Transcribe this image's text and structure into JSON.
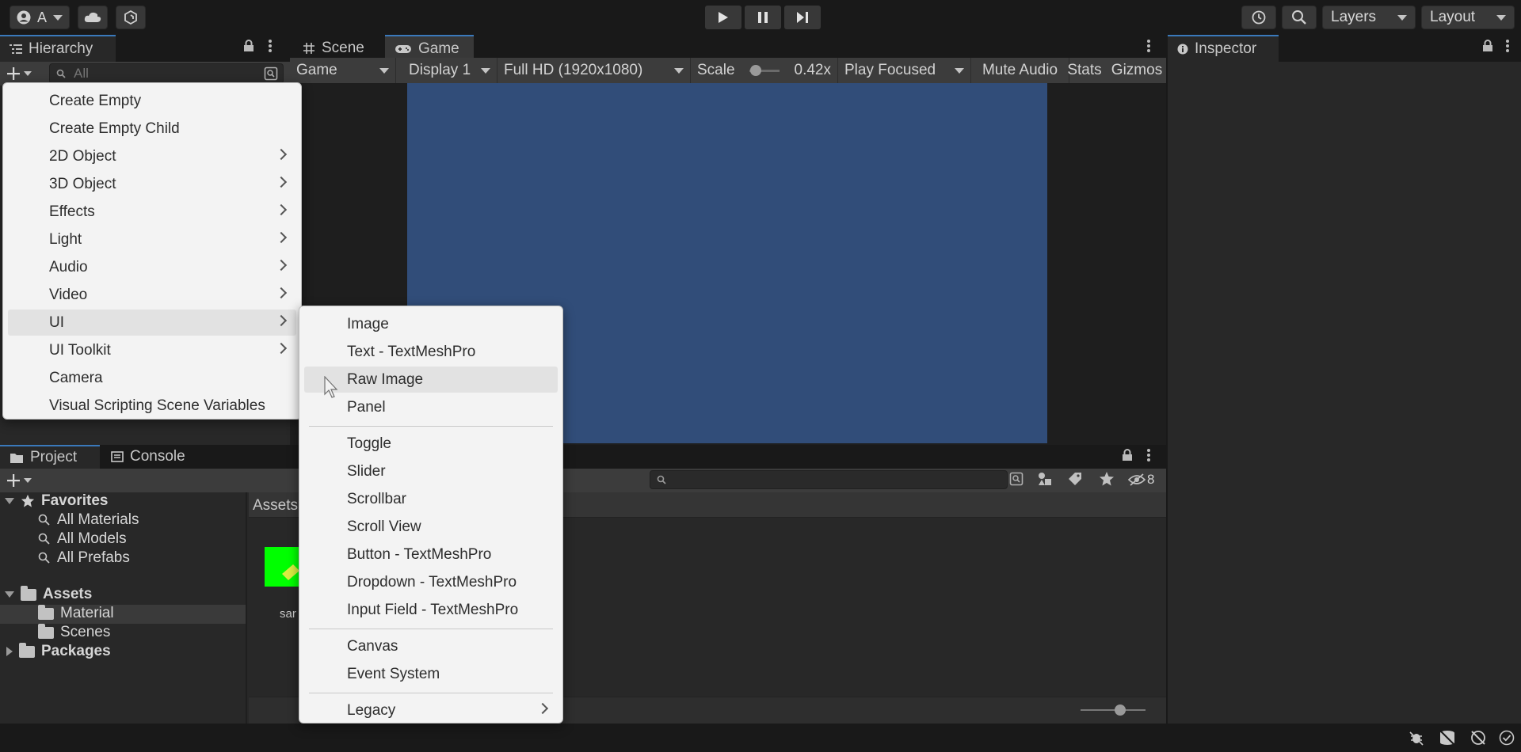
{
  "toolbar": {
    "account_initial": "A",
    "layers_label": "Layers",
    "layout_label": "Layout"
  },
  "hierarchy": {
    "tab_label": "Hierarchy",
    "search_placeholder": "All"
  },
  "center_tabs": {
    "scene_label": "Scene",
    "game_label": "Game"
  },
  "game_toolbar": {
    "game_select": "Game",
    "display_select": "Display 1",
    "resolution_select": "Full HD (1920x1080)",
    "scale_label": "Scale",
    "scale_value": "0.42x",
    "scale_level": 0.05,
    "play_mode_select": "Play Focused",
    "mute_audio_label": "Mute Audio",
    "stats_label": "Stats",
    "gizmos_label": "Gizmos"
  },
  "game_view": {
    "background_color": "#314d79"
  },
  "inspector": {
    "tab_label": "Inspector"
  },
  "bottom_tabs": {
    "project_label": "Project",
    "console_label": "Console",
    "hidden_count": "8"
  },
  "project_tree": {
    "favorites_label": "Favorites",
    "favorites": [
      "All Materials",
      "All Models",
      "All Prefabs"
    ],
    "assets_label": "Assets",
    "asset_folders": [
      "Material",
      "Scenes"
    ],
    "packages_label": "Packages"
  },
  "asset_browser": {
    "breadcrumb": "Assets",
    "asset_name": "sar",
    "thumbnail_color": "#00ff00"
  },
  "create_menu": {
    "items": [
      {
        "label": "Create Empty",
        "submenu": false
      },
      {
        "label": "Create Empty Child",
        "submenu": false
      },
      {
        "label": "2D Object",
        "submenu": true
      },
      {
        "label": "3D Object",
        "submenu": true
      },
      {
        "label": "Effects",
        "submenu": true
      },
      {
        "label": "Light",
        "submenu": true
      },
      {
        "label": "Audio",
        "submenu": true
      },
      {
        "label": "Video",
        "submenu": true
      },
      {
        "label": "UI",
        "submenu": true
      },
      {
        "label": "UI Toolkit",
        "submenu": true
      },
      {
        "label": "Camera",
        "submenu": false
      },
      {
        "label": "Visual Scripting Scene Variables",
        "submenu": false
      }
    ],
    "highlighted": "UI"
  },
  "ui_submenu": {
    "groups": [
      [
        "Image",
        "Text - TextMeshPro",
        "Raw Image",
        "Panel"
      ],
      [
        "Toggle",
        "Slider",
        "Scrollbar",
        "Scroll View",
        "Button - TextMeshPro",
        "Dropdown - TextMeshPro",
        "Input Field - TextMeshPro"
      ],
      [
        "Canvas",
        "Event System"
      ],
      [
        "Legacy"
      ]
    ],
    "highlighted": "Raw Image",
    "submenu_item": "Legacy"
  }
}
